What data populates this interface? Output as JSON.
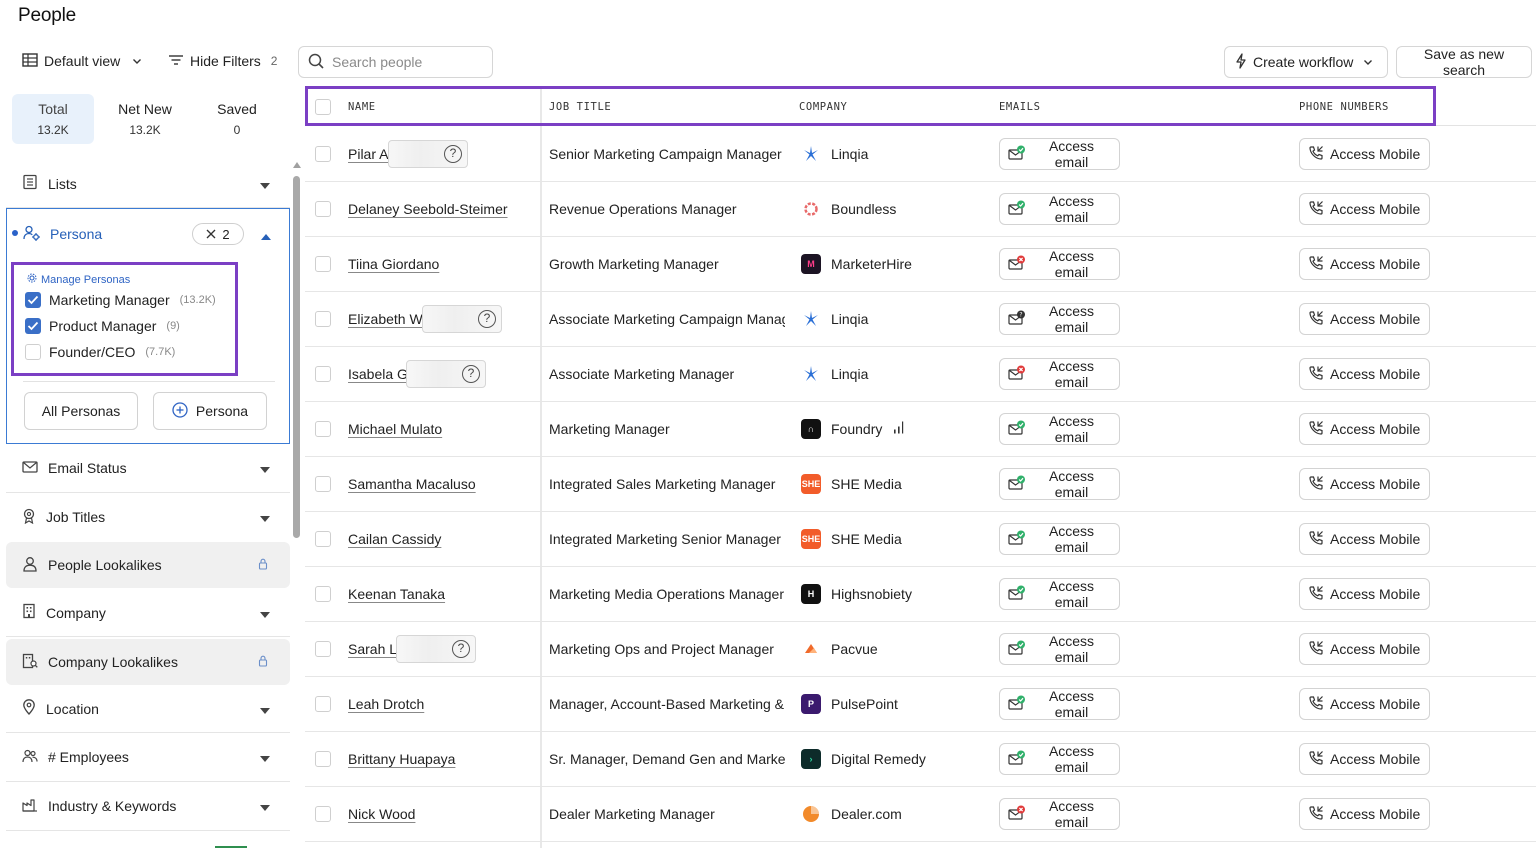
{
  "page_title": "People",
  "toolbar": {
    "view_label": "Default view",
    "filters_label": "Hide Filters",
    "filters_count": "2",
    "search_placeholder": "Search people",
    "workflow_label": "Create workflow",
    "save_label": "Save as new search"
  },
  "tabs": [
    {
      "label": "Total",
      "value": "13.2K"
    },
    {
      "label": "Net New",
      "value": "13.2K"
    },
    {
      "label": "Saved",
      "value": "0"
    }
  ],
  "sidebar": {
    "lists_label": "Lists",
    "persona": {
      "label": "Persona",
      "count": "2",
      "manage_label": "Manage Personas",
      "options": [
        {
          "label": "Marketing Manager",
          "count": "(13.2K)",
          "checked": true
        },
        {
          "label": "Product Manager",
          "count": "(9)",
          "checked": true
        },
        {
          "label": "Founder/CEO",
          "count": "(7.7K)",
          "checked": false
        }
      ],
      "all_button": "All Personas",
      "add_button": "Persona"
    },
    "sections": [
      {
        "label": "Email Status"
      },
      {
        "label": "Job Titles"
      },
      {
        "label": "People Lookalikes"
      },
      {
        "label": "Company"
      },
      {
        "label": "Company Lookalikes"
      },
      {
        "label": "Location"
      },
      {
        "label": "# Employees"
      },
      {
        "label": "Industry & Keywords"
      }
    ]
  },
  "table": {
    "headers": [
      "NAME",
      "JOB TITLE",
      "COMPANY",
      "EMAILS",
      "PHONE NUMBERS"
    ],
    "email_button": "Access email",
    "mobile_button": "Access Mobile",
    "rows": [
      {
        "name": "Pilar A",
        "masked": true,
        "job": "Senior Marketing Campaign Manager",
        "company": "Linqia",
        "email_status": "verified"
      },
      {
        "name": "Delaney Seebold-Steimer",
        "masked": false,
        "job": "Revenue Operations Manager",
        "company": "Boundless",
        "email_status": "verified"
      },
      {
        "name": "Tiina Giordano",
        "masked": false,
        "job": "Growth Marketing Manager",
        "company": "MarketerHire",
        "email_status": "invalid"
      },
      {
        "name": "Elizabeth W",
        "masked": true,
        "job": "Associate Marketing Campaign Manager",
        "company": "Linqia",
        "email_status": "unknown"
      },
      {
        "name": "Isabela G",
        "masked": true,
        "job": "Associate Marketing Manager",
        "company": "Linqia",
        "email_status": "invalid"
      },
      {
        "name": "Michael Mulato",
        "masked": false,
        "job": "Marketing Manager",
        "company": "Foundry",
        "email_status": "verified"
      },
      {
        "name": "Samantha Macaluso",
        "masked": false,
        "job": "Integrated Sales Marketing Manager",
        "company": "SHE Media",
        "email_status": "verified"
      },
      {
        "name": "Cailan Cassidy",
        "masked": false,
        "job": "Integrated Marketing Senior Manager",
        "company": "SHE Media",
        "email_status": "verified"
      },
      {
        "name": "Keenan Tanaka",
        "masked": false,
        "job": "Marketing Media Operations Manager",
        "company": "Highsnobiety",
        "email_status": "verified"
      },
      {
        "name": "Sarah L",
        "masked": true,
        "job": "Marketing Ops and Project Manager",
        "company": "Pacvue",
        "email_status": "verified"
      },
      {
        "name": "Leah Drotch",
        "masked": false,
        "job": "Manager, Account-Based Marketing & Demand Gen",
        "company": "PulsePoint",
        "email_status": "verified"
      },
      {
        "name": "Brittany Huapaya",
        "masked": false,
        "job": "Sr. Manager, Demand Gen and Marketing Ops",
        "company": "Digital Remedy",
        "email_status": "verified"
      },
      {
        "name": "Nick Wood",
        "masked": false,
        "job": "Dealer Marketing Manager",
        "company": "Dealer.com",
        "email_status": "invalid"
      }
    ]
  },
  "colors": {
    "accent": "#3a6fc7",
    "highlight": "#7b3fc4",
    "verified": "#2fb06a",
    "invalid": "#e03a3a"
  }
}
